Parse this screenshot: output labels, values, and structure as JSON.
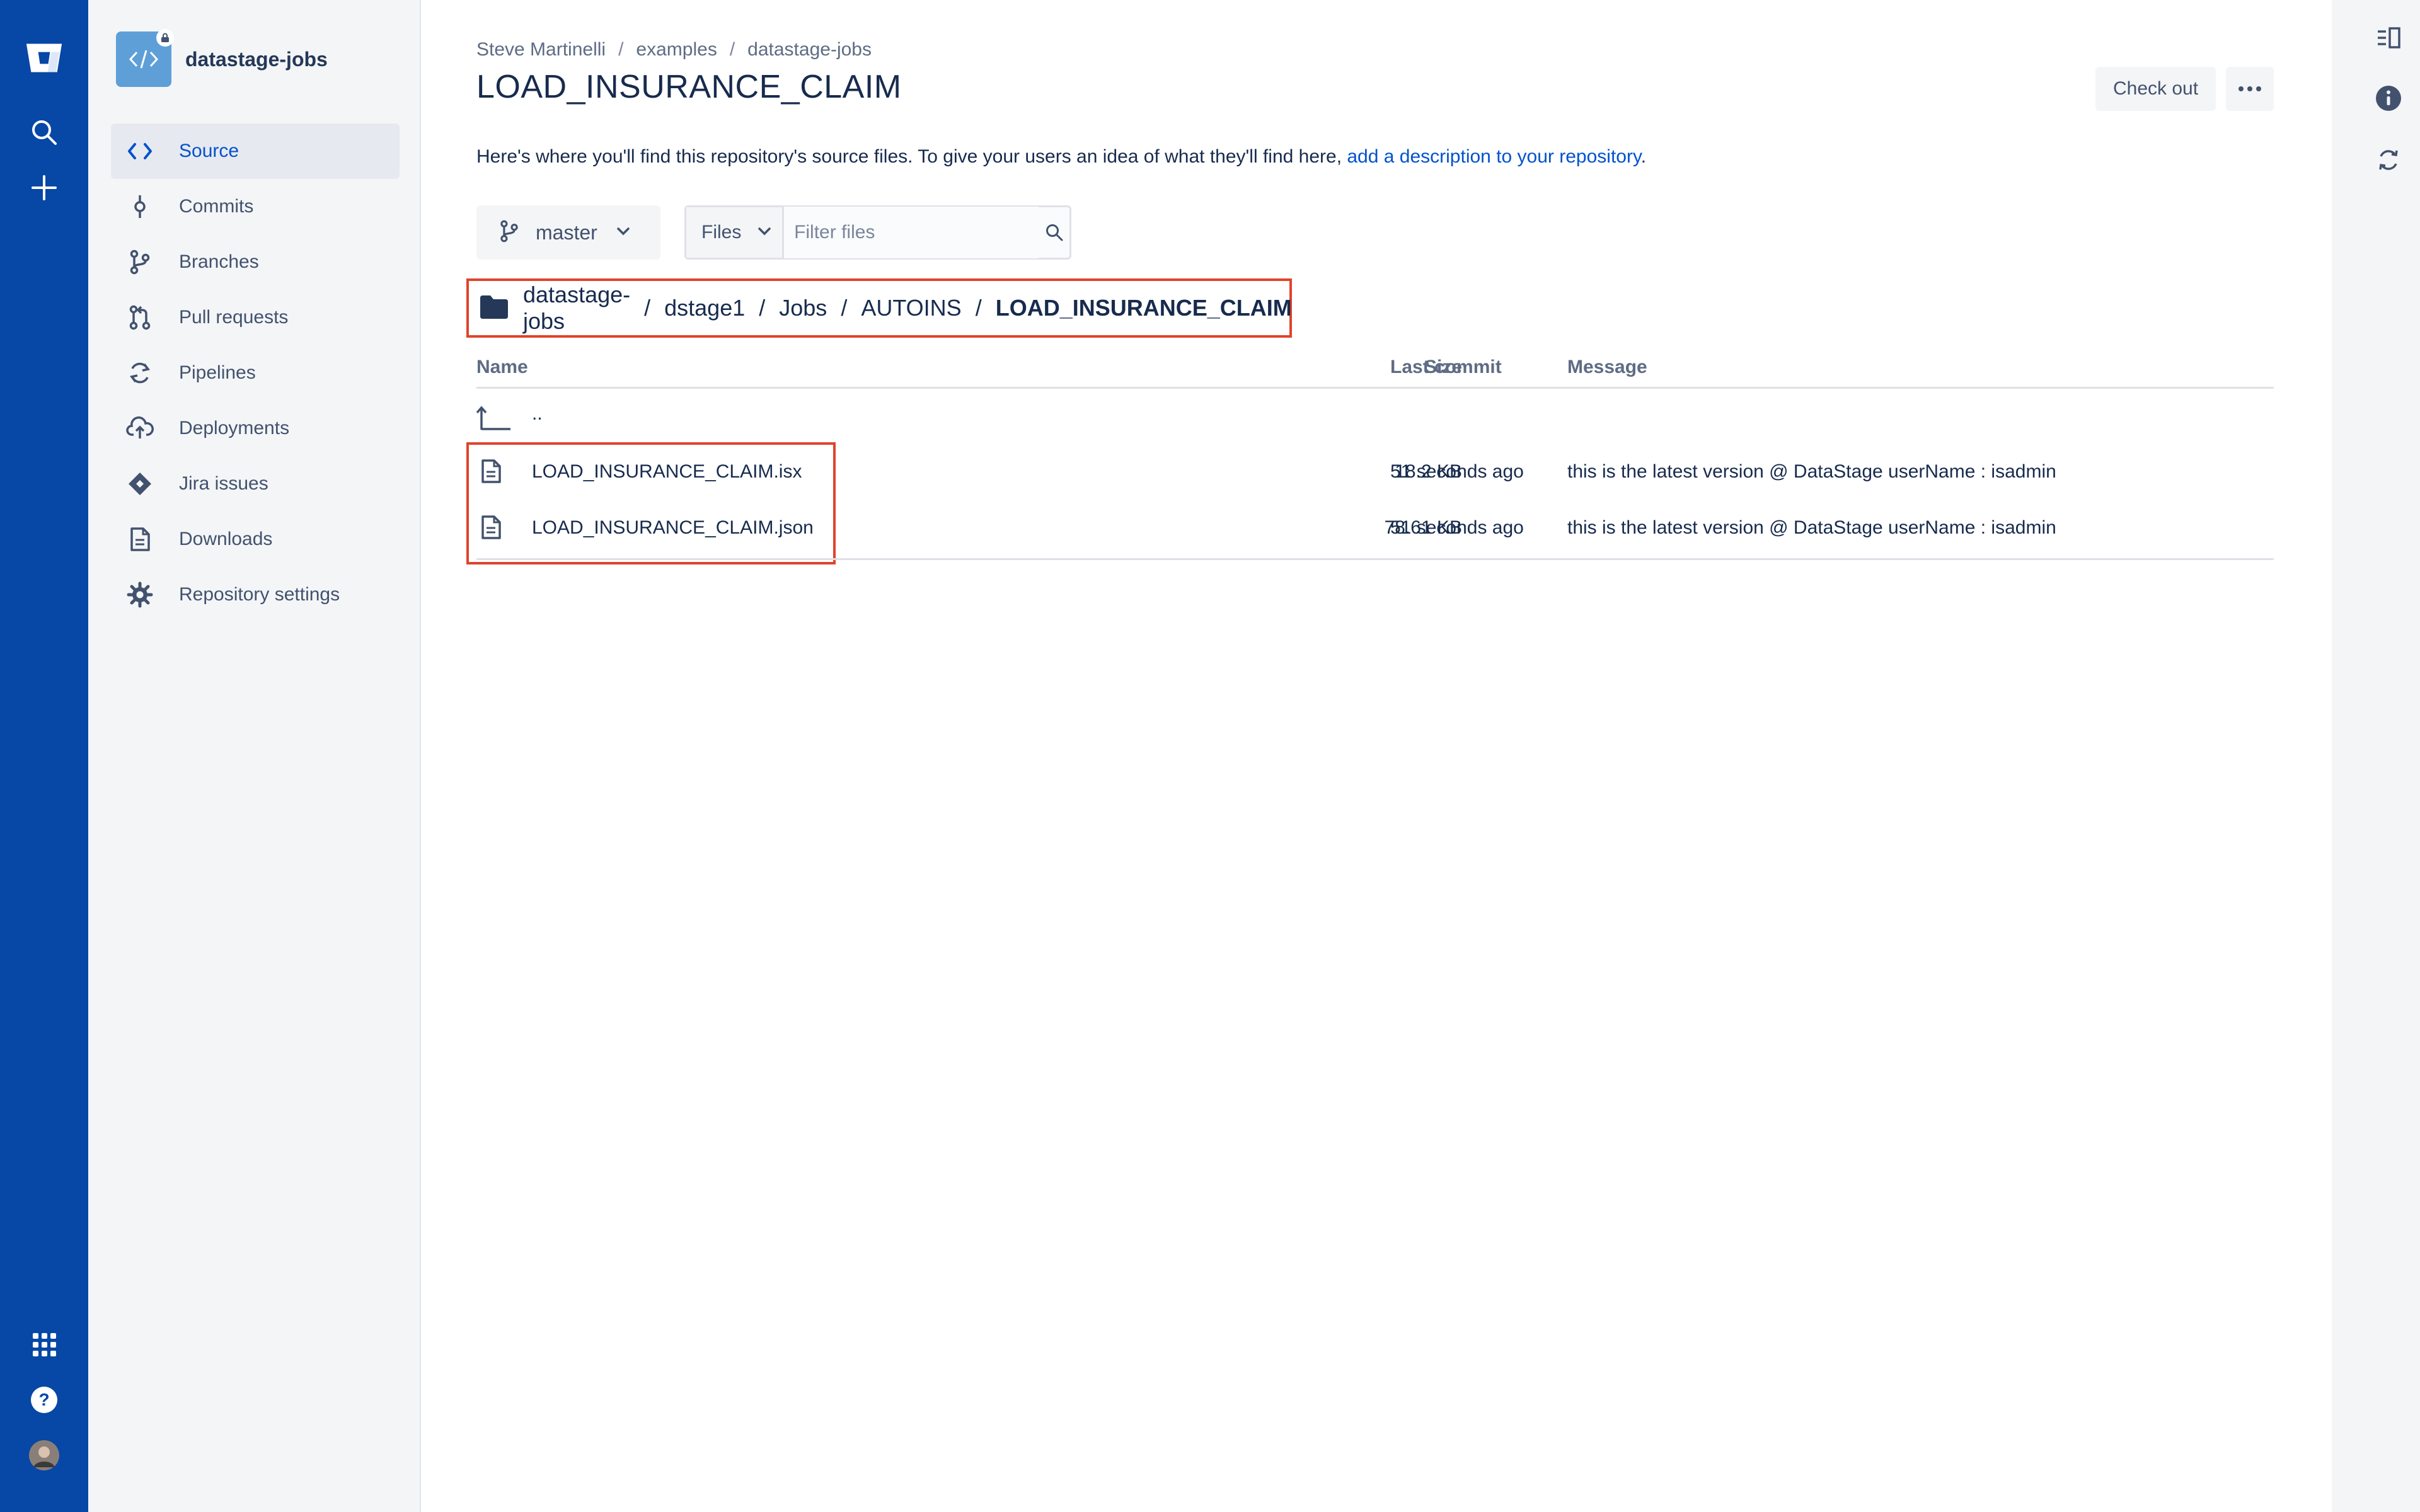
{
  "repo": {
    "name": "datastage-jobs"
  },
  "sidebar": {
    "items": [
      {
        "label": "Source",
        "icon": "code-icon"
      },
      {
        "label": "Commits",
        "icon": "commit-icon"
      },
      {
        "label": "Branches",
        "icon": "branch-icon"
      },
      {
        "label": "Pull requests",
        "icon": "pull-request-icon"
      },
      {
        "label": "Pipelines",
        "icon": "pipelines-icon"
      },
      {
        "label": "Deployments",
        "icon": "cloud-upload-icon"
      },
      {
        "label": "Jira issues",
        "icon": "jira-icon"
      },
      {
        "label": "Downloads",
        "icon": "document-icon"
      },
      {
        "label": "Repository settings",
        "icon": "gear-icon"
      }
    ]
  },
  "header": {
    "breadcrumb": [
      "Steve Martinelli",
      "examples",
      "datastage-jobs"
    ],
    "title": "LOAD_INSURANCE_CLAIM",
    "checkout_label": "Check out"
  },
  "intro": {
    "text": "Here's where you'll find this repository's source files. To give your users an idea of what they'll find here, ",
    "link": "add a description to your repository",
    "end": "."
  },
  "toolbar": {
    "branch": "master",
    "files_label": "Files",
    "filter_placeholder": "Filter files"
  },
  "path": {
    "segments": [
      "datastage-jobs",
      "dstage1",
      "Jobs",
      "AUTOINS",
      "LOAD_INSURANCE_CLAIM"
    ]
  },
  "table": {
    "headers": {
      "name": "Name",
      "size": "Size",
      "last_commit": "Last commit",
      "message": "Message"
    },
    "parent": "..",
    "rows": [
      {
        "name": "LOAD_INSURANCE_CLAIM.isx",
        "size": "18.2 KB",
        "last_commit": "51 seconds ago",
        "message": "this is the latest version @ DataStage userName : isadmin"
      },
      {
        "name": "LOAD_INSURANCE_CLAIM.json",
        "size": "78.61 KB",
        "last_commit": "51 seconds ago",
        "message": "this is the latest version @ DataStage userName : isadmin"
      }
    ]
  },
  "colors": {
    "global_nav": "#0747a6",
    "accent": "#0052cc",
    "highlight_box": "#e0432b"
  }
}
